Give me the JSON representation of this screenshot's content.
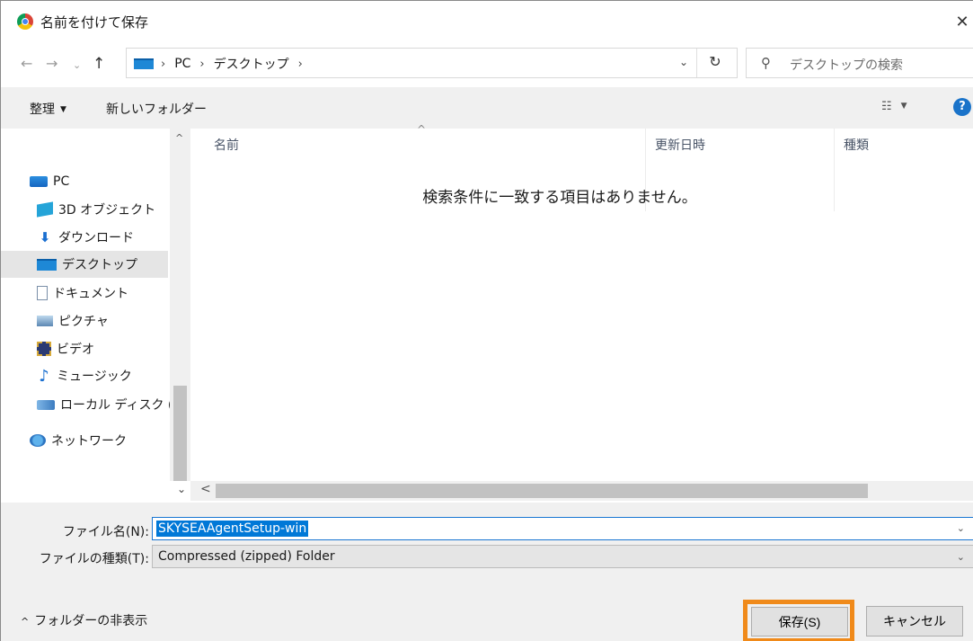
{
  "window": {
    "title": "名前を付けて保存",
    "close_glyph": "✕"
  },
  "nav": {
    "back_glyph": "←",
    "forward_glyph": "→",
    "recent_glyph": "⌄",
    "up_glyph": "↑",
    "refresh_glyph": "↻",
    "address_dropdown_glyph": "⌄",
    "path": [
      "PC",
      "デスクトップ"
    ],
    "path_sep": "›",
    "search_placeholder": "デスクトップの検索",
    "search_glyph": "⚲"
  },
  "toolbar": {
    "organize_label": "整理",
    "organize_caret": "▼",
    "new_folder_label": "新しいフォルダー",
    "view_glyph": "☷",
    "view_caret": "▼",
    "help_glyph": "?"
  },
  "navpane": {
    "items": [
      {
        "label": "PC",
        "icon": "pc-icon"
      },
      {
        "label": "3D オブジェクト",
        "icon": "3d-objects-icon"
      },
      {
        "label": "ダウンロード",
        "icon": "download-icon",
        "glyph": "⬇"
      },
      {
        "label": "デスクトップ",
        "icon": "desktop-icon",
        "selected": true
      },
      {
        "label": "ドキュメント",
        "icon": "documents-icon"
      },
      {
        "label": "ピクチャ",
        "icon": "pictures-icon"
      },
      {
        "label": "ビデオ",
        "icon": "videos-icon"
      },
      {
        "label": "ミュージック",
        "icon": "music-icon",
        "glyph": "♪"
      },
      {
        "label": "ローカル ディスク (C",
        "icon": "local-disk-icon"
      },
      {
        "label": "ネットワーク",
        "icon": "network-icon"
      }
    ],
    "scroll_up_glyph": "^"
  },
  "filelist": {
    "columns": [
      "名前",
      "更新日時",
      "種類"
    ],
    "sort_glyph": "^",
    "empty_message": "検索条件に一致する項目はありません。"
  },
  "scroll": {
    "down_glyph": "⌄",
    "left_glyph": "<"
  },
  "form": {
    "filename_label": "ファイル名(N):",
    "filename_value": "SKYSEAAgentSetup-win",
    "filetype_label": "ファイルの種類(T):",
    "filetype_value": "Compressed (zipped) Folder",
    "dropdown_glyph": "⌄",
    "hide_folders_label": "フォルダーの非表示",
    "hide_folders_glyph": "^",
    "save_label": "保存(S)",
    "cancel_label": "キャンセル",
    "highlight_color": "#f08a1a"
  }
}
